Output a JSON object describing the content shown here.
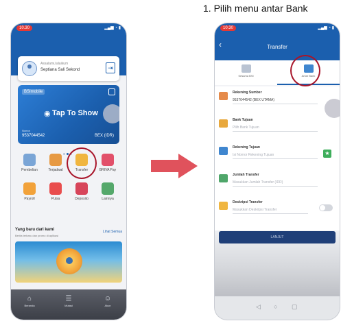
{
  "caption": "1.  Pilih menu antar Bank",
  "colors": {
    "brand_blue": "#1b5fae",
    "highlight_ring": "#a8152a",
    "arrow": "#e0525c"
  },
  "left_screen": {
    "status_time": "10.30",
    "welcome_label": "Assalamu'alaikum",
    "user_name": "Septiana Sali Sekond",
    "card": {
      "tap_to_show": "Tap To Show",
      "account_label": "Nomor",
      "account_number": "9537044542",
      "currency": "BEX (IDR)"
    },
    "menu": [
      {
        "label": "Pembelian",
        "icon": "purchase-icon",
        "color": "#7aa5d6"
      },
      {
        "label": "Terjadwal",
        "icon": "schedule-icon",
        "color": "#e79a43"
      },
      {
        "label": "Transfer",
        "icon": "transfer-icon",
        "color": "#f0b640"
      },
      {
        "label": "BRIVA Pay",
        "icon": "briva-icon",
        "color": "#e2506a"
      },
      {
        "label": "Payroll",
        "icon": "payroll-icon",
        "color": "#f2a23a"
      },
      {
        "label": "Pulsa",
        "icon": "phone-credit-icon",
        "color": "#e94d4d"
      },
      {
        "label": "Deposito",
        "icon": "deposit-icon",
        "color": "#d7455a"
      },
      {
        "label": "Lainnya",
        "icon": "more-icon",
        "color": "#55a86b"
      }
    ],
    "promo": {
      "title": "Yang baru dari kami",
      "subtitle": "Berita terbaru dan promo di aplikasi",
      "link": "Lihat Semua"
    },
    "nav": [
      {
        "label": "Beranda",
        "glyph": "⌂",
        "icon": "home-icon"
      },
      {
        "label": "Mutasi",
        "glyph": "☰",
        "icon": "mutation-icon"
      },
      {
        "label": "Akun",
        "glyph": "☺",
        "icon": "profile-icon"
      }
    ]
  },
  "right_screen": {
    "status_time": "10.30",
    "title": "Transfer",
    "tabs": [
      {
        "label": "Sesama BSI",
        "icon": "same-bank-icon"
      },
      {
        "label": "Antar Bank",
        "icon": "inter-bank-icon"
      }
    ],
    "fields": [
      {
        "label": "Rekening Sumber",
        "value": "9537044542 (BEX UTAMA)",
        "icon": "wallet-icon",
        "color": "#e58a4a"
      },
      {
        "label": "Bank Tujuan",
        "value": "Pilih Bank Tujuan",
        "icon": "bank-icon",
        "color": "#e8a83d"
      },
      {
        "label": "Rekening Tujuan",
        "value": "Isi Nomor Rekening Tujuan",
        "icon": "account-card-icon",
        "color": "#3f86cf"
      },
      {
        "label": "Jumlah Transfer",
        "value": "Masukkan Jumlah Transfer (IDR)",
        "icon": "money-icon",
        "color": "#4fa66a"
      },
      {
        "label": "Deskripsi Transfer",
        "value": "Masukkan Deskripsi Transfer",
        "icon": "notes-icon",
        "color": "#f0b640"
      }
    ],
    "next_label": "LANJUT"
  }
}
